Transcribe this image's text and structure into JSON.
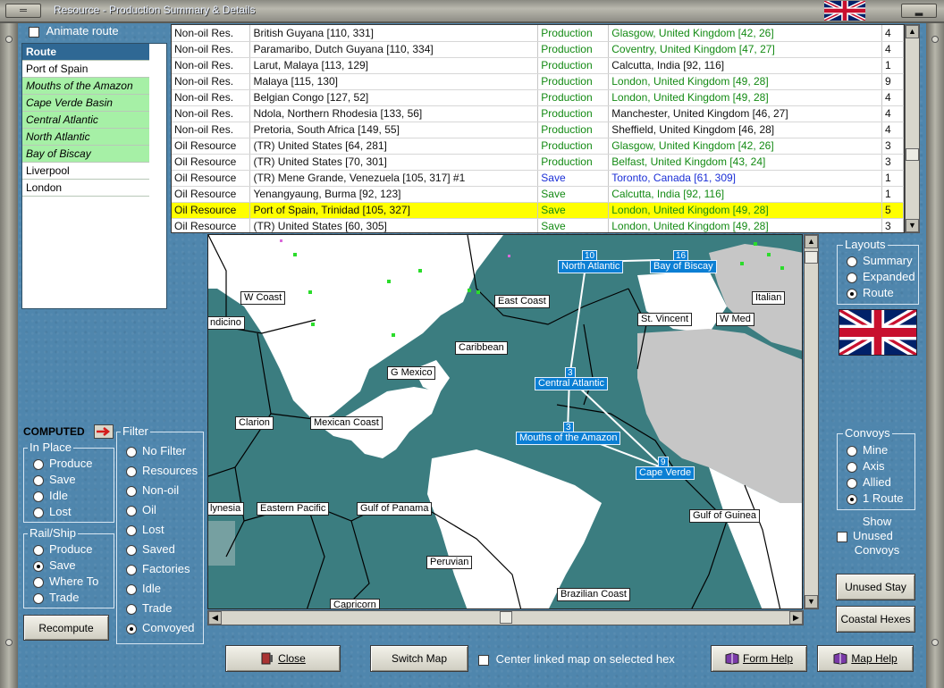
{
  "window": {
    "title": "Resource - Production Summary & Details"
  },
  "animate_route": {
    "label": "Animate route",
    "checked": false
  },
  "route_list": {
    "header": "Route",
    "items": [
      {
        "label": "Port of Spain",
        "highlight": false
      },
      {
        "label": "Mouths of the Amazon",
        "highlight": true
      },
      {
        "label": "Cape Verde Basin",
        "highlight": true
      },
      {
        "label": "Central Atlantic",
        "highlight": true
      },
      {
        "label": "North Atlantic",
        "highlight": true
      },
      {
        "label": "Bay of Biscay",
        "highlight": true
      },
      {
        "label": "Liverpool",
        "highlight": false
      },
      {
        "label": "London",
        "highlight": false
      }
    ]
  },
  "table": {
    "rows": [
      {
        "type": "Non-oil Res.",
        "location": "British Guyana [110, 331]",
        "status": "Production",
        "dest": "Glasgow, United Kingdom [42, 26]",
        "count": "4",
        "status_color": "green",
        "dest_color": "green"
      },
      {
        "type": "Non-oil Res.",
        "location": "Paramaribo, Dutch Guyana [110, 334]",
        "status": "Production",
        "dest": "Coventry, United Kingdom [47, 27]",
        "count": "4",
        "status_color": "green",
        "dest_color": "green"
      },
      {
        "type": "Non-oil Res.",
        "location": "Larut, Malaya [113, 129]",
        "status": "Production",
        "dest": "Calcutta, India [92, 116]",
        "count": "1",
        "status_color": "green",
        "dest_color": "black"
      },
      {
        "type": "Non-oil Res.",
        "location": "Malaya [115, 130]",
        "status": "Production",
        "dest": "London, United Kingdom [49, 28]",
        "count": "9",
        "status_color": "green",
        "dest_color": "green"
      },
      {
        "type": "Non-oil Res.",
        "location": "Belgian Congo [127, 52]",
        "status": "Production",
        "dest": "London, United Kingdom [49, 28]",
        "count": "4",
        "status_color": "green",
        "dest_color": "green"
      },
      {
        "type": "Non-oil Res.",
        "location": "Ndola, Northern Rhodesia [133, 56]",
        "status": "Production",
        "dest": "Manchester, United Kingdom [46, 27]",
        "count": "4",
        "status_color": "green",
        "dest_color": "black"
      },
      {
        "type": "Non-oil Res.",
        "location": "Pretoria, South Africa [149, 55]",
        "status": "Production",
        "dest": "Sheffield, United Kingdom [46, 28]",
        "count": "4",
        "status_color": "green",
        "dest_color": "black"
      },
      {
        "type": "Oil Resource",
        "location": "(TR) United States [64, 281]",
        "status": "Production",
        "dest": "Glasgow, United Kingdom [42, 26]",
        "count": "3",
        "status_color": "green",
        "dest_color": "green"
      },
      {
        "type": "Oil Resource",
        "location": "(TR) United States [70, 301]",
        "status": "Production",
        "dest": "Belfast, United Kingdom [43, 24]",
        "count": "3",
        "status_color": "green",
        "dest_color": "green"
      },
      {
        "type": "Oil Resource",
        "location": "(TR) Mene Grande, Venezuela [105, 317] #1",
        "status": "Save",
        "dest": "Toronto, Canada [61, 309]",
        "count": "1",
        "status_color": "blue",
        "dest_color": "blue"
      },
      {
        "type": "Oil Resource",
        "location": "Yenangyaung, Burma [92, 123]",
        "status": "Save",
        "dest": "Calcutta, India [92, 116]",
        "count": "1",
        "status_color": "green",
        "dest_color": "green"
      },
      {
        "type": "Oil Resource",
        "location": "Port of Spain, Trinidad [105, 327]",
        "status": "Save",
        "dest": "London, United Kingdom [49, 28]",
        "count": "5",
        "status_color": "green",
        "dest_color": "green",
        "selected": true
      },
      {
        "type": "Oil Resource",
        "location": "(TR) United States [60, 305]",
        "status": "Save",
        "dest": "London, United Kingdom [49, 28]",
        "count": "3",
        "status_color": "green",
        "dest_color": "green"
      }
    ]
  },
  "map": {
    "region_labels": [
      "W Coast",
      "ndicino",
      "East Coast",
      "Italian",
      "St. Vincent",
      "W Med",
      "Caribbean",
      "G Mexico",
      "Clarion",
      "Mexican Coast",
      "lynesia",
      "Eastern Pacific",
      "Gulf of Panama",
      "Gulf of Guinea",
      "Peruvian",
      "Brazilian Coast",
      "Capricorn"
    ],
    "convoy_zones": [
      {
        "label": "North Atlantic",
        "count": "10"
      },
      {
        "label": "Bay of Biscay",
        "count": "16"
      },
      {
        "label": "Central Atlantic",
        "count": "3"
      },
      {
        "label": "Mouths of the Amazon",
        "count": "3"
      },
      {
        "label": "Cape Verde",
        "count": "9"
      }
    ]
  },
  "layouts": {
    "title": "Layouts",
    "options": [
      {
        "label": "Summary",
        "selected": false
      },
      {
        "label": "Expanded",
        "selected": false
      },
      {
        "label": "Route",
        "selected": true
      }
    ]
  },
  "convoys": {
    "title": "Convoys",
    "options": [
      {
        "label": "Mine",
        "selected": false
      },
      {
        "label": "Axis",
        "selected": false
      },
      {
        "label": "Allied",
        "selected": false
      },
      {
        "label": "1 Route",
        "selected": true
      }
    ]
  },
  "show_unused": {
    "line1": "Show",
    "line2": "Unused",
    "line3": "Convoys",
    "checked": false
  },
  "computed": {
    "label": "COMPUTED"
  },
  "in_place": {
    "title": "In Place",
    "options": [
      {
        "label": "Produce",
        "selected": false
      },
      {
        "label": "Save",
        "selected": false
      },
      {
        "label": "Idle",
        "selected": false
      },
      {
        "label": "Lost",
        "selected": false
      }
    ]
  },
  "rail_ship": {
    "title": "Rail/Ship",
    "options": [
      {
        "label": "Produce",
        "selected": false
      },
      {
        "label": "Save",
        "selected": true
      },
      {
        "label": "Where To",
        "selected": false
      },
      {
        "label": "Trade",
        "selected": false
      }
    ]
  },
  "filter": {
    "title": "Filter",
    "options": [
      {
        "label": "No Filter",
        "selected": false
      },
      {
        "label": "Resources",
        "selected": false
      },
      {
        "label": "Non-oil",
        "selected": false
      },
      {
        "label": "Oil",
        "selected": false
      },
      {
        "label": "Lost",
        "selected": false
      },
      {
        "label": "Saved",
        "selected": false
      },
      {
        "label": "Factories",
        "selected": false
      },
      {
        "label": "Idle",
        "selected": false
      },
      {
        "label": "Trade",
        "selected": false
      },
      {
        "label": "Convoyed",
        "selected": true
      }
    ]
  },
  "buttons": {
    "recompute": "Recompute",
    "close": "Close",
    "switch_map": "Switch Map",
    "form_help": "Form Help",
    "map_help": "Map Help",
    "unused_stay": "Unused Stay",
    "coastal_hexes": "Coastal Hexes"
  },
  "center_linked": {
    "label": "Center linked map on selected hex",
    "checked": false
  },
  "colors": {
    "background": "#4f86ad",
    "sea": "#3b7d80",
    "convoy_label": "#0b7fd4",
    "selected_row": "#ffff00",
    "route_highlight": "#a6f0a6"
  }
}
